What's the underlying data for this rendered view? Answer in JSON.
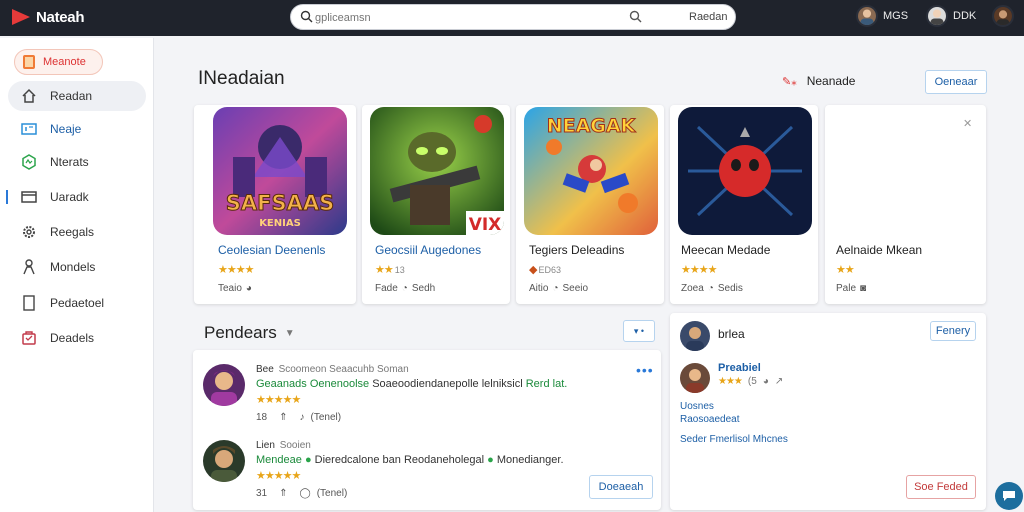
{
  "app": {
    "logo_text": "Nateah"
  },
  "search": {
    "placeholder": "gpliceamsn",
    "value": "",
    "action_label": "Raedan"
  },
  "top_users": [
    {
      "label": "MGS"
    },
    {
      "label": "DDK"
    }
  ],
  "sidebar": {
    "brand_label": "Meanote",
    "items": [
      {
        "label": "Readan",
        "icon": "home-icon"
      },
      {
        "label": "Neaje",
        "icon": "id-card-icon"
      },
      {
        "label": "Nterats",
        "icon": "hexagon-icon"
      },
      {
        "label": "Uaradk",
        "icon": "folder-icon"
      },
      {
        "label": "Reegals",
        "icon": "gear-icon"
      },
      {
        "label": "Mondels",
        "icon": "person-icon"
      },
      {
        "label": "Pedaetoel",
        "icon": "document-icon"
      },
      {
        "label": "Deadels",
        "icon": "bag-icon"
      }
    ]
  },
  "main": {
    "title": "INeadaian",
    "filter_label": "Neanade",
    "filter_icon": "sparkle-icon",
    "header_button": "Oeneaar"
  },
  "games": [
    {
      "title": "Ceolesian Deenenls",
      "title_color": "#1d5fa6",
      "stars": "★★★★",
      "rating": "",
      "meta": "Teaio",
      "meta_icon": "chat-icon",
      "art_text": "SAFSAAS",
      "art_sub": "KENIAS"
    },
    {
      "title": "Geocsiil Augedones",
      "title_color": "#1d5fa6",
      "stars": "★★",
      "rating": "13",
      "meta": "Fade",
      "meta_icon": "chat-icon",
      "meta_extra": "Sedh",
      "art_text": "VIX"
    },
    {
      "title": "Tegiers Deleadins",
      "title_color": "#222222",
      "stars": "◆",
      "rating": "ED63",
      "meta": "Aitio",
      "meta_icon": "chat-icon",
      "meta_extra": "Seeio",
      "art_text": "NEAGAK"
    },
    {
      "title": "Meecan Medade",
      "title_color": "#222222",
      "stars": "★★★★",
      "rating": "",
      "meta": "Zoea",
      "meta_icon": "chat-icon",
      "meta_extra": "Sedis",
      "art_text": ""
    },
    {
      "title": "Aelnaide Mkean",
      "title_color": "#222222",
      "stars": "★★",
      "rating": "",
      "meta": "Pale",
      "meta_icon": "chat-icon",
      "art_text": ""
    }
  ],
  "reviews_panel": {
    "title": "Pendears",
    "toggle_label": "▾ •",
    "items": [
      {
        "user": "Bee",
        "user_sub": "Scoomeon Seaacuhb Soman",
        "text_hl": "Geaanads Oenenoolse",
        "text": "Soaeoodiendanepolle lelniksicl",
        "text_end": "Rerd lat.",
        "stars": "★★★★★",
        "likes": "18",
        "replies": "(Tenel)"
      },
      {
        "user": "Lien",
        "user_sub": "Sooien",
        "text_hl": "Mendeae",
        "text": "Dieredcalone ban Reodaneholegal",
        "text_end": "Monedianger.",
        "stars": "★★★★★",
        "likes": "31",
        "replies": "(Tenel)"
      }
    ],
    "footer_button": "Doeaeah"
  },
  "side_panel": {
    "header": "brlea",
    "header_button": "Fenery",
    "item_title": "Preabiel",
    "item_stars": "★★★",
    "item_rating": "(5",
    "links": [
      "Uosnes",
      "Raosoaedeat",
      "Seder Fmerlisol Mhcnes"
    ],
    "action_button": "Soe Feded"
  },
  "colors": {
    "accent": "#1d5fa6",
    "topbar": "#1f232c",
    "danger": "#d33a3a",
    "star": "#e8a519"
  }
}
